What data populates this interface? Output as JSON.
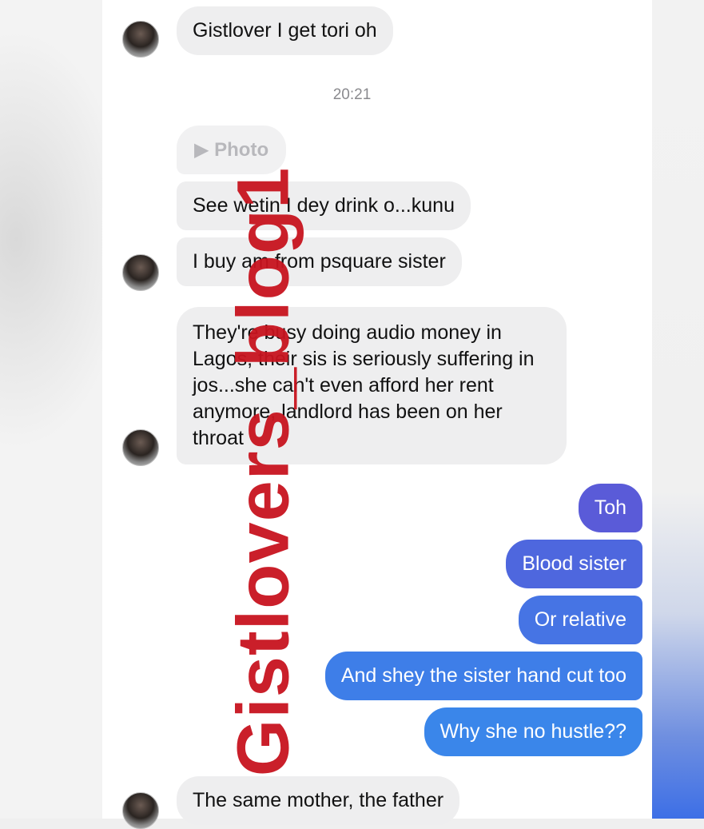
{
  "watermark": "Gistlovers_blog1",
  "timestamp": "20:21",
  "photo_label": "Photo",
  "messages": {
    "m1": "Gistlover I get tori oh",
    "m2": "See wetin I dey drink o...kunu",
    "m3": "I buy am from psquare sister",
    "m4": "They're busy doing audio money in Lagos, their sis is seriously suffering in jos...she can't even afford her rent anymore, landlord has been on her throat",
    "o1": "Toh",
    "o2": "Blood sister",
    "o3": "Or relative",
    "o4": "And shey the sister hand cut too",
    "o5": "Why she no hustle??",
    "m5": "The same mother, the father"
  },
  "colors": {
    "outgoing_top": "#5a5bd8",
    "outgoing_bottom": "#3a86ea",
    "incoming": "#eeeeef",
    "watermark": "#c8141f"
  }
}
